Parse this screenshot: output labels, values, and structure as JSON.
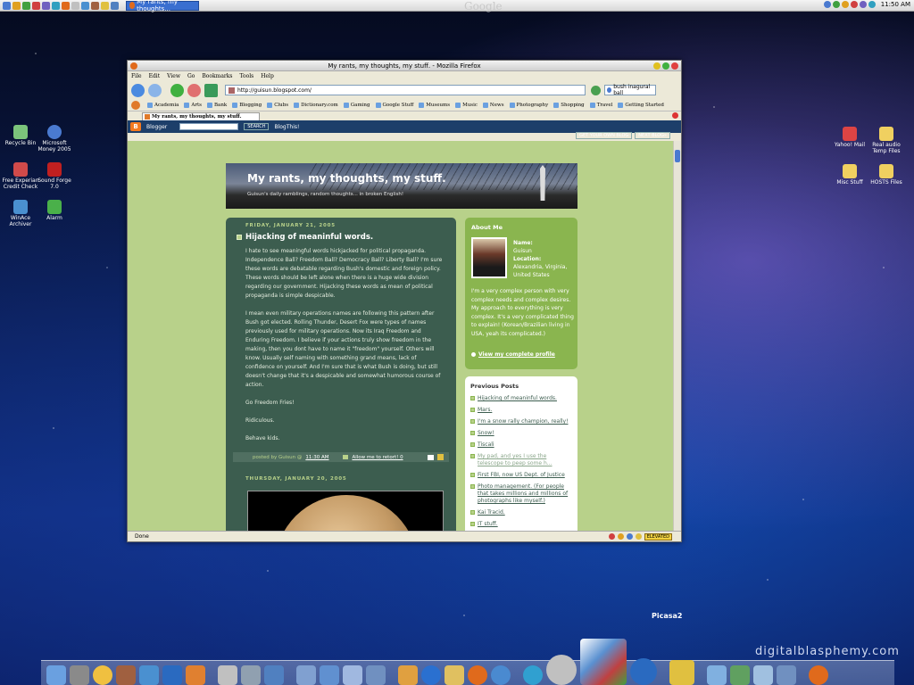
{
  "taskbar": {
    "task_title": "My rants, my thoughts...",
    "google_label": "Google",
    "clock": "11:50 AM",
    "quicklaunch": [
      "app-icon",
      "app-icon",
      "app-icon",
      "app-icon",
      "app-icon",
      "app-icon",
      "app-icon",
      "app-icon",
      "app-icon",
      "app-icon",
      "app-icon",
      "app-icon"
    ]
  },
  "desktop_left": [
    {
      "label": "Recycle Bin",
      "color": "#7bc47b"
    },
    {
      "label": "Microsoft Money 2005",
      "color": "#4a7ad0"
    },
    {
      "label": "Free Experian Credit Check",
      "color": "#d04a4a"
    },
    {
      "label": "Sound Forge 7.0",
      "color": "#c02020"
    },
    {
      "label": "WinAce Archiver",
      "color": "#4a90d0"
    },
    {
      "label": "Alarm",
      "color": "#4ab04a"
    }
  ],
  "desktop_right": [
    {
      "label": "Yahoo! Mail",
      "color": "#d44"
    },
    {
      "label": "Real audio Temp Files",
      "color": "#f0d060"
    },
    {
      "label": "Misc Stuff",
      "color": "#f0d060"
    },
    {
      "label": "HOSTS Files",
      "color": "#f0d060"
    }
  ],
  "window": {
    "title": "My rants, my thoughts, my stuff. - Mozilla Firefox",
    "menu": [
      "File",
      "Edit",
      "View",
      "Go",
      "Bookmarks",
      "Tools",
      "Help"
    ],
    "url": "http://guisun.blogspot.com/",
    "search": "bush inagural ball",
    "bookmarks": [
      "Academia",
      "Arts",
      "Bank",
      "Blogging",
      "Clubs",
      "Dictionary.com",
      "Gaming",
      "Google Stuff",
      "Museums",
      "Music",
      "News",
      "Photography",
      "Shopping",
      "Travel",
      "Getting Started"
    ],
    "tab_title": "My rants, my thoughts, my stuff.",
    "status": "Done",
    "elevated": "ELEVATED",
    "mail_count": "0"
  },
  "blogger": {
    "logo": "B",
    "name": "Blogger",
    "search_btn": "SEARCH",
    "blogthis": "BlogThis!",
    "get_own": "GET YOUR OWN BLOG",
    "next": "NEXT BLOG»"
  },
  "blog": {
    "title": "My rants, my thoughts, my stuff.",
    "description": "Guisun's daily ramblings, random thoughts... in broken English!"
  },
  "post": {
    "date": "FRIDAY, JANUARY 21, 2005",
    "title": "Hijacking of meaninful words.",
    "paragraphs": [
      "I hate to see meaningful words hickjacked for political propaganda. Independence Ball? Freedom Ball? Democracy Ball? Liberty Ball? I'm sure these words are debatable regarding Bush's domestic and foreign policy. These words should be left alone when there is a huge wide division regarding our government. Hijacking these words as mean of political propaganda is simple despicable.",
      "I mean even military operations names are following this pattern after Bush got elected. Rolling Thunder, Desert Fox were types of names previously used for military operations. Now its Iraq Freedom and Enduring Freedom. I believe if your actions truly show freedom in the making, then you dont have to name it \"freedom\" yourself. Others will know. Usually self naming with something grand means, lack of confidence on yourself. And I'm sure that is what Bush is doing, but still doesn't change that it's a despicable and somewhat humorous course of action.",
      "Go Freedom Fries!",
      "Ridiculous.",
      "Behave kids."
    ],
    "footer_prefix": "posted by Guisun @",
    "footer_time": "11:30 AM",
    "footer_comment": "Allow me to retort! 0"
  },
  "post2": {
    "date": "THURSDAY, JANUARY 20, 2005"
  },
  "about": {
    "heading": "About Me",
    "name_label": "Name:",
    "name": "Guisun",
    "location_label": "Location:",
    "location": "Alexandria, Virginia, United States",
    "text": "I'm a very complex person with very complex needs and complex desires. My approach to everything is very complex. It's a very complicated thing to explain! (Korean/Brazilian living in USA, yeah its complicated.)",
    "profile_link": "View my complete profile"
  },
  "previous": {
    "heading": "Previous Posts",
    "items": [
      {
        "t": "Hijacking of meaninful words.",
        "dim": false
      },
      {
        "t": "Mars.",
        "dim": false
      },
      {
        "t": "I'm a snow rally champion, really!",
        "dim": false
      },
      {
        "t": "Snow!",
        "dim": false
      },
      {
        "t": "Tiscali",
        "dim": false
      },
      {
        "t": "My pad, and yes I use the telescope to peep some h...",
        "dim": true
      },
      {
        "t": "First FBI, now US Dept. of Justice",
        "dim": false
      },
      {
        "t": "Photo management. (For people that takes millions and millions of photographs like myself.)",
        "dim": false
      },
      {
        "t": "Kai Tracid.",
        "dim": false
      },
      {
        "t": "IT stuff.",
        "dim": false
      }
    ]
  },
  "dock": {
    "picasa_label": "Picasa2",
    "watermark": "digitalblasphemy.com"
  }
}
